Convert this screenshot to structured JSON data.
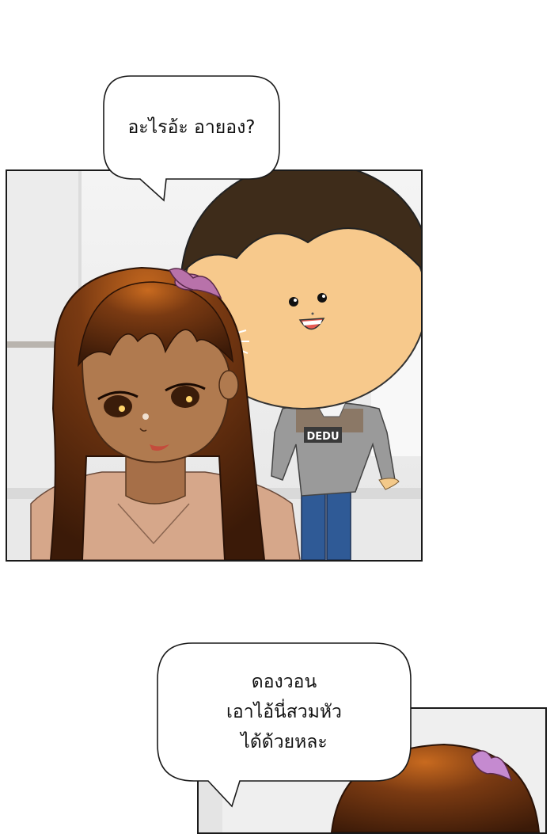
{
  "bubble_top": {
    "text": "อะไรอ้ะ อายอง?"
  },
  "shirt_logo": "DEDU",
  "bubble_bottom": {
    "lines": [
      "ดองวอน",
      "เอาไอ้นี่สวมหัว",
      "ได้ด้วยหละ"
    ]
  }
}
